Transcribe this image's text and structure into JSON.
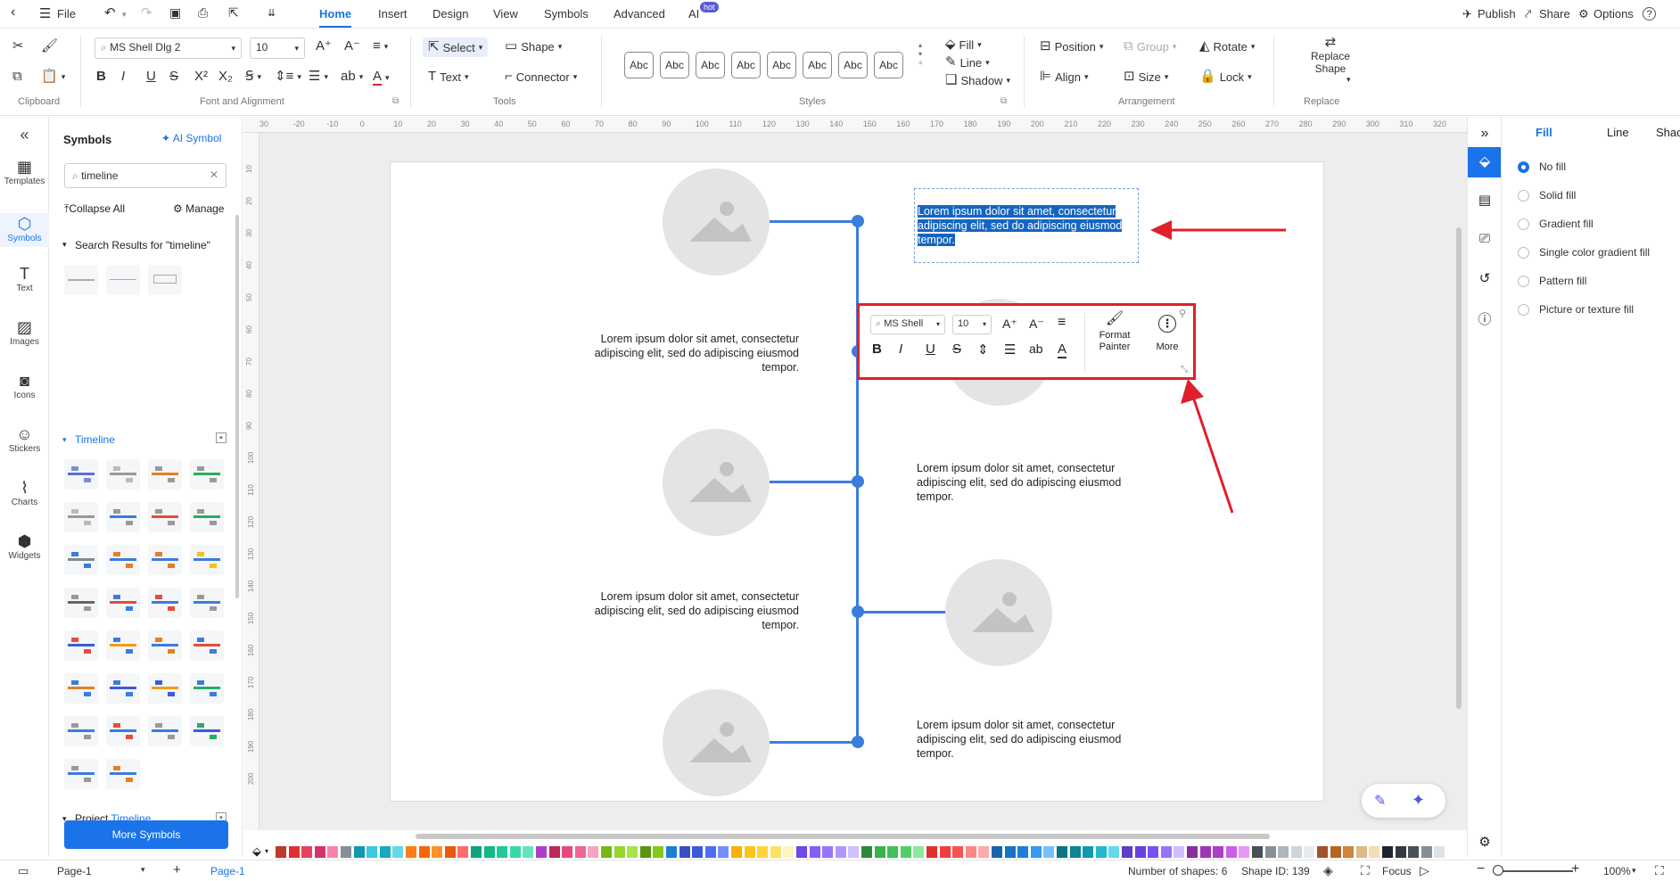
{
  "menubar": {
    "file_label": "File",
    "tabs": [
      {
        "label": "Home"
      },
      {
        "label": "Insert"
      },
      {
        "label": "Design"
      },
      {
        "label": "View"
      },
      {
        "label": "Symbols"
      },
      {
        "label": "Advanced"
      },
      {
        "label": "AI"
      }
    ],
    "hot_badge": "hot",
    "right": {
      "publish": "Publish",
      "share": "Share",
      "options": "Options",
      "help": "?"
    }
  },
  "ribbon": {
    "groups": {
      "clipboard": "Clipboard",
      "font_alignment": "Font and Alignment",
      "tools": "Tools",
      "styles": "Styles",
      "arrangement": "Arrangement",
      "replace": "Replace"
    },
    "font_name": "MS Shell Dlg 2",
    "font_size": "10",
    "tools": {
      "select": "Select",
      "shape": "Shape",
      "text": "Text",
      "connector": "Connector"
    },
    "style_preset": "Abc",
    "style_props": {
      "fill": "Fill",
      "line": "Line",
      "shadow": "Shadow"
    },
    "arrangement": {
      "position": "Position",
      "group": "Group",
      "rotate": "Rotate",
      "align": "Align",
      "size": "Size",
      "lock": "Lock"
    },
    "replace_shape_l1": "Replace",
    "replace_shape_l2": "Shape"
  },
  "leftrail": [
    {
      "label": "Templates"
    },
    {
      "label": "Symbols"
    },
    {
      "label": "Text"
    },
    {
      "label": "Images"
    },
    {
      "label": "Icons"
    },
    {
      "label": "Stickers"
    },
    {
      "label": "Charts"
    },
    {
      "label": "Widgets"
    }
  ],
  "symbols_panel": {
    "title": "Symbols",
    "ai_symbol": "AI Symbol",
    "search_value": "timeline",
    "collapse_all": "Collapse All",
    "manage": "Manage",
    "search_results_label": "Search Results for  \"timeline\"",
    "section_timeline": "Timeline",
    "section_project_prefix": "Project ",
    "section_project_hl": "Timeline",
    "more_symbols": "More Symbols"
  },
  "canvas": {
    "lorem": "Lorem ipsum dolor sit amet, consectetur adipiscing elit, sed do adipiscing eiusmod tempor.",
    "selected_line1": "Lorem ipsum dolor sit amet, consectetur",
    "selected_line2": "adipiscing elit, sed do adipiscing eiusmod",
    "selected_line3": "tempor.",
    "ruler_h": [
      "30",
      "-20",
      "-10",
      "0",
      "10",
      "20",
      "30",
      "40",
      "50",
      "60",
      "70",
      "80",
      "90",
      "100",
      "110",
      "120",
      "130",
      "140",
      "150",
      "160",
      "170",
      "180",
      "190",
      "200",
      "210",
      "220",
      "230",
      "240",
      "250",
      "260",
      "270",
      "280",
      "290",
      "300",
      "310",
      "320"
    ],
    "ruler_v": [
      "10",
      "20",
      "30",
      "40",
      "50",
      "60",
      "70",
      "80",
      "90",
      "100",
      "110",
      "120",
      "130",
      "140",
      "150",
      "160",
      "170",
      "180",
      "190",
      "200"
    ]
  },
  "floating_toolbar": {
    "font": "MS Shell",
    "size": "10",
    "format_painter_l1": "Format",
    "format_painter_l2": "Painter",
    "more": "More"
  },
  "right_panel": {
    "tabs": {
      "fill": "Fill",
      "line": "Line",
      "shadow": "Shac"
    },
    "options": [
      {
        "label": "No fill",
        "selected": true
      },
      {
        "label": "Solid fill",
        "selected": false
      },
      {
        "label": "Gradient fill",
        "selected": false
      },
      {
        "label": "Single color gradient fill",
        "selected": false
      },
      {
        "label": "Pattern fill",
        "selected": false
      },
      {
        "label": "Picture or texture fill",
        "selected": false
      }
    ]
  },
  "statusbar": {
    "page_tab": "Page-1",
    "page_active": "Page-1",
    "shapes": "Number of shapes: 6",
    "shape_id": "Shape ID: 139",
    "focus": "Focus",
    "zoom": "100%"
  },
  "colors": {
    "accent": "#1a73e8",
    "timeline_blue": "#3b7ddd",
    "annotation_red": "#e0202a",
    "selection_bg": "#1565c0"
  },
  "palette_colors": [
    "#c0392b",
    "#e03131",
    "#e8425a",
    "#d6336c",
    "#f783ac",
    "#868e96",
    "#1098ad",
    "#3bc9db",
    "#15aabf",
    "#66d9e8",
    "#fd7e14",
    "#f76707",
    "#ff922b",
    "#e8590c",
    "#ff6b6b",
    "#0ca678",
    "#12b886",
    "#20c997",
    "#38d9a9",
    "#63e6be",
    "#ae3ec9",
    "#c2255c",
    "#e64980",
    "#f06595",
    "#faa2c1",
    "#74b816",
    "#94d82d",
    "#a9e34b",
    "#5c940d",
    "#82c91e",
    "#1c7ed6",
    "#364fc7",
    "#3b5bdb",
    "#4c6ef5",
    "#748ffc",
    "#fab005",
    "#fcc419",
    "#ffd43b",
    "#ffe066",
    "#fff3bf",
    "#7048e8",
    "#845ef7",
    "#9775fa",
    "#b197fc",
    "#d0bfff",
    "#2b8a3e",
    "#37b24d",
    "#40c057",
    "#51cf66",
    "#8ce99a",
    "#e03131",
    "#f03e3e",
    "#fa5252",
    "#ff8787",
    "#ffa8a8",
    "#1864ab",
    "#1971c2",
    "#1c7ed6",
    "#339af0",
    "#74c0fc",
    "#0b7285",
    "#0c8599",
    "#1098ad",
    "#22b8cf",
    "#66d9e8",
    "#5f3dc4",
    "#6741d9",
    "#7950f2",
    "#9775fa",
    "#d0bfff",
    "#862e9c",
    "#9c36b5",
    "#ae3ec9",
    "#cc5de8",
    "#e599f7",
    "#495057",
    "#868e96",
    "#adb5bd",
    "#ced4da",
    "#e9ecef",
    "#a0522d",
    "#b5651d",
    "#cd853f",
    "#deb887",
    "#f5deb3",
    "#212529",
    "#343a40",
    "#495057",
    "#868e96",
    "#dee2e6"
  ]
}
